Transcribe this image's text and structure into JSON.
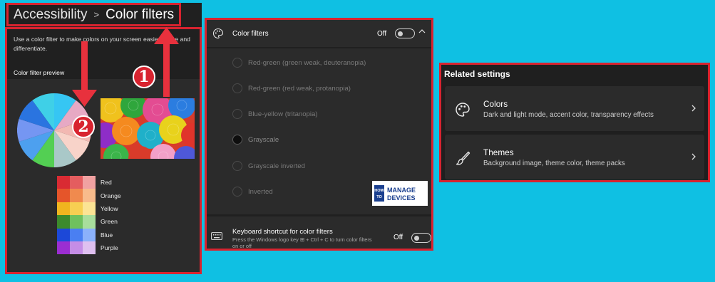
{
  "breadcrumb": {
    "parent": "Accessibility",
    "separator": ">",
    "current": "Color filters"
  },
  "description": "Use a color filter to make colors on your screen easier to see and differentiate.",
  "preview": {
    "title": "Color filter preview",
    "swatches": [
      {
        "label": "Red",
        "colors": [
          "#d92b33",
          "#e45d5f",
          "#f0a1a1"
        ]
      },
      {
        "label": "Orange",
        "colors": [
          "#e5552a",
          "#f08a4e",
          "#f8bc8c"
        ]
      },
      {
        "label": "Yellow",
        "colors": [
          "#f0b51f",
          "#f7cf52",
          "#fbe494"
        ]
      },
      {
        "label": "Green",
        "colors": [
          "#3c8a2c",
          "#6fc15e",
          "#a8de9c"
        ]
      },
      {
        "label": "Blue",
        "colors": [
          "#1c48d8",
          "#4a7ff2",
          "#8bb1fb"
        ]
      },
      {
        "label": "Purple",
        "colors": [
          "#9b2ed2",
          "#c58de6",
          "#dfc0f0"
        ]
      }
    ],
    "pie_colors": [
      "#36c6f3",
      "#e7a9c4",
      "#f2b8b2",
      "#f8d3c9",
      "#a9c8c8",
      "#53cf53",
      "#4da0ef",
      "#7596f2",
      "#2a74e0",
      "#3fd0e7"
    ]
  },
  "annotations": {
    "badge_1": "1",
    "badge_2": "2"
  },
  "color_filters": {
    "title": "Color filters",
    "state": "Off",
    "options": [
      {
        "label": "Red-green (green weak, deuteranopia)",
        "selected": false
      },
      {
        "label": "Red-green (red weak, protanopia)",
        "selected": false
      },
      {
        "label": "Blue-yellow (tritanopia)",
        "selected": false
      },
      {
        "label": "Grayscale",
        "selected": true
      },
      {
        "label": "Grayscale inverted",
        "selected": false
      },
      {
        "label": "Inverted",
        "selected": false
      }
    ]
  },
  "logo": {
    "line1": "HOW",
    "line2": "TO",
    "word1": "MANAGE",
    "word2": "DEVICES"
  },
  "keyboard_shortcut": {
    "title": "Keyboard shortcut for color filters",
    "subtitle": "Press the Windows logo key ⊞ + Ctrl + C to turn color filters on or off",
    "state": "Off"
  },
  "related_settings": {
    "title": "Related settings",
    "items": [
      {
        "name": "Colors",
        "description": "Dark and light mode, accent color, transparency effects",
        "icon": "palette-icon"
      },
      {
        "name": "Themes",
        "description": "Background image, theme color, theme packs",
        "icon": "brush-icon"
      }
    ]
  },
  "colors": {
    "background": "#0fc0e3",
    "panel": "#202020",
    "card": "#2b2b2b",
    "highlight": "#d8232f"
  }
}
